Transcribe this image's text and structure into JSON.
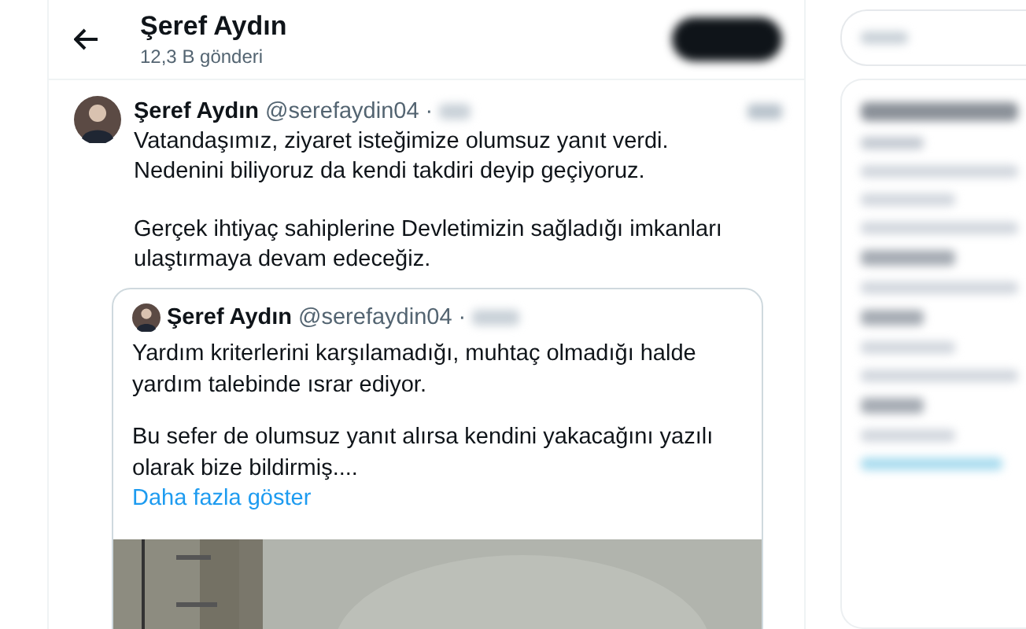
{
  "header": {
    "title": "Şeref Aydın",
    "subtitle": "12,3 B gönderi"
  },
  "tweet": {
    "author": "Şeref Aydın",
    "handle": "@serefaydin04",
    "separator": "·",
    "paragraphs": [
      "Vatandaşımız, ziyaret isteğimize olumsuz yanıt verdi. Nedenini biliyoruz da kendi takdiri deyip geçiyoruz.",
      "Gerçek ihtiyaç sahiplerine Devletimizin sağladığı imkanları ulaştırmaya devam edeceğiz."
    ]
  },
  "quote": {
    "author": "Şeref Aydın",
    "handle": "@serefaydin04",
    "separator": "·",
    "paragraphs": [
      "Yardım kriterlerini karşılamadığı, muhtaç olmadığı halde yardım talebinde ısrar ediyor.",
      "Bu sefer de olumsuz yanıt alırsa kendini yakacağını yazılı olarak bize bildirmiş...."
    ],
    "more_link": "Daha fazla göster"
  }
}
